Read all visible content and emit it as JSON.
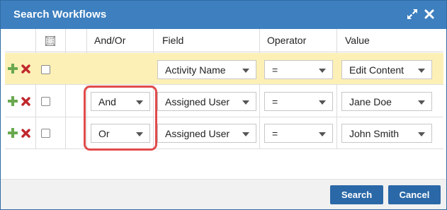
{
  "dialog": {
    "title": "Search Workflows",
    "icons": {
      "expand": "expand-icon",
      "close": "close-icon"
    }
  },
  "table": {
    "columns": {
      "select_all_icon": "select-all-icon",
      "and_or": "And/Or",
      "field": "Field",
      "operator": "Operator",
      "value": "Value"
    },
    "rows": [
      {
        "and_or": "",
        "field": "Activity Name",
        "operator": "=",
        "value": "Edit Content",
        "checked": false,
        "highlighted": true
      },
      {
        "and_or": "And",
        "field": "Assigned User",
        "operator": "=",
        "value": "Jane Doe",
        "checked": false,
        "highlighted": false
      },
      {
        "and_or": "Or",
        "field": "Assigned User",
        "operator": "=",
        "value": "John Smith",
        "checked": false,
        "highlighted": false
      }
    ]
  },
  "footer": {
    "search_label": "Search",
    "cancel_label": "Cancel"
  },
  "colors": {
    "titlebar": "#3d7fbf",
    "highlight_row": "#fdf0b6",
    "button": "#2b68a7",
    "add_icon": "#6aa84f",
    "remove_icon": "#c0282d",
    "callout": "#e24a4a"
  }
}
